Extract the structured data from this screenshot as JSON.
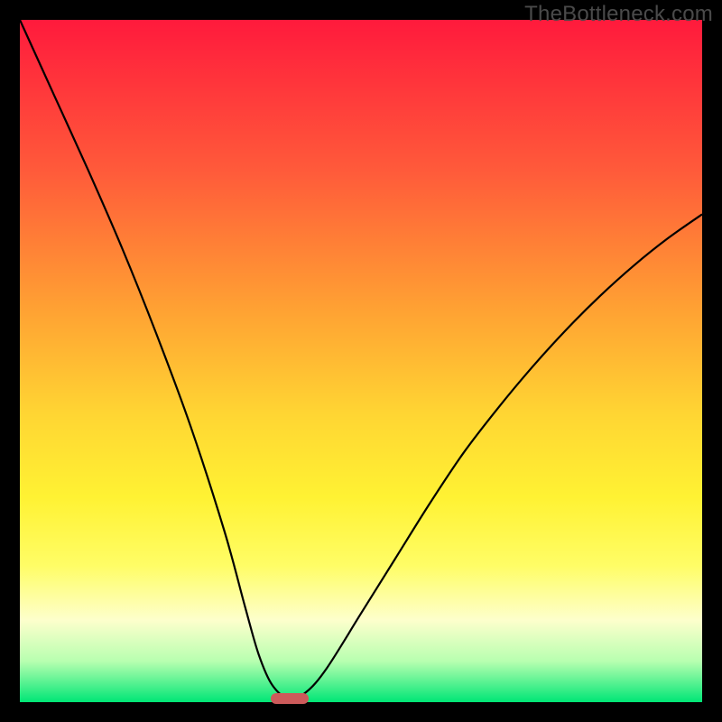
{
  "watermark": "TheBottleneck.com",
  "chart_data": {
    "type": "line",
    "title": "",
    "xlabel": "",
    "ylabel": "",
    "xlim": [
      0,
      100
    ],
    "ylim": [
      0,
      100
    ],
    "curve": {
      "x": [
        0,
        5,
        10,
        15,
        20,
        25,
        30,
        33,
        35,
        37,
        39.5,
        42,
        45,
        50,
        55,
        60,
        65,
        70,
        75,
        80,
        85,
        90,
        95,
        100
      ],
      "y": [
        100,
        89,
        78,
        66.5,
        54,
        40.5,
        25,
        14,
        7,
        2.5,
        0.5,
        1.5,
        5,
        13,
        21,
        29,
        36.5,
        43,
        49,
        54.5,
        59.5,
        64,
        68,
        71.5
      ]
    },
    "marker": {
      "x": 39.5,
      "y": 0.5
    },
    "colors": {
      "top": "#ff1a3c",
      "upper_mid": "#ffa033",
      "mid": "#fff233",
      "lower_mid": "#fdffcc",
      "bottom": "#00e676",
      "curve": "#000000",
      "marker": "#cc5a5a",
      "frame": "#000000"
    }
  }
}
